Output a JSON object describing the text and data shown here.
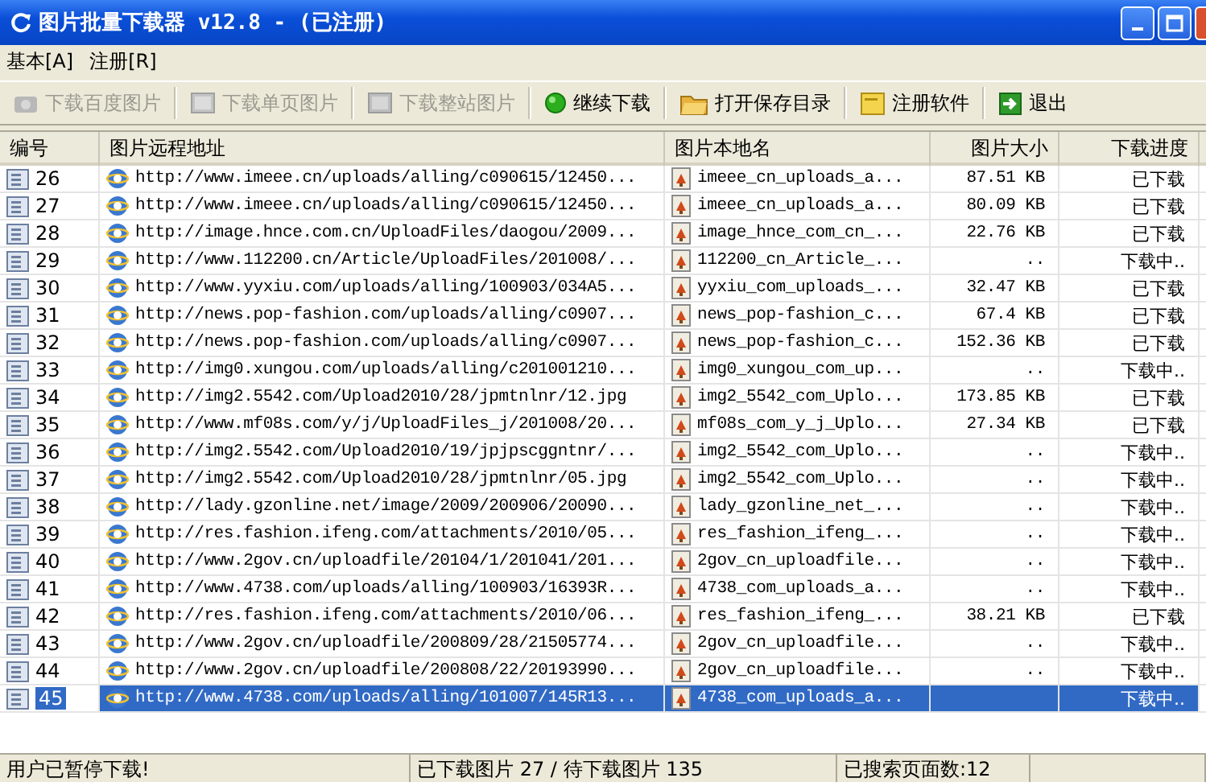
{
  "window": {
    "title": "图片批量下载器 v12.8 - (已注册)"
  },
  "menu": [
    "基本[A]",
    "注册[R]"
  ],
  "toolbar": [
    {
      "label": "下载百度图片",
      "disabled": true
    },
    {
      "label": "下载单页图片",
      "disabled": true
    },
    {
      "label": "下载整站图片",
      "disabled": true
    },
    {
      "label": "继续下载",
      "disabled": false
    },
    {
      "label": "打开保存目录",
      "disabled": false
    },
    {
      "label": "注册软件",
      "disabled": false
    },
    {
      "label": "退出",
      "disabled": false
    }
  ],
  "table": {
    "columns": [
      "编号",
      "图片远程地址",
      "图片本地名",
      "图片大小",
      "下载进度"
    ],
    "rows": [
      {
        "number": "26",
        "url": "http://www.imeee.cn/uploads/alling/c090615/12450...",
        "local_name": "imeee_cn_uploads_a...",
        "size": "87.51 KB",
        "progress": "已下载",
        "selected": false
      },
      {
        "number": "27",
        "url": "http://www.imeee.cn/uploads/alling/c090615/12450...",
        "local_name": "imeee_cn_uploads_a...",
        "size": "80.09 KB",
        "progress": "已下载",
        "selected": false
      },
      {
        "number": "28",
        "url": "http://image.hnce.com.cn/UploadFiles/daogou/2009...",
        "local_name": "image_hnce_com_cn_...",
        "size": "22.76 KB",
        "progress": "已下载",
        "selected": false
      },
      {
        "number": "29",
        "url": "http://www.112200.cn/Article/UploadFiles/201008/...",
        "local_name": "112200_cn_Article_...",
        "size": "..",
        "progress": "下载中..",
        "selected": false
      },
      {
        "number": "30",
        "url": "http://www.yyxiu.com/uploads/alling/100903/034A5...",
        "local_name": "yyxiu_com_uploads_...",
        "size": "32.47 KB",
        "progress": "已下载",
        "selected": false
      },
      {
        "number": "31",
        "url": "http://news.pop-fashion.com/uploads/alling/c0907...",
        "local_name": "news_pop-fashion_c...",
        "size": "67.4 KB",
        "progress": "已下载",
        "selected": false
      },
      {
        "number": "32",
        "url": "http://news.pop-fashion.com/uploads/alling/c0907...",
        "local_name": "news_pop-fashion_c...",
        "size": "152.36 KB",
        "progress": "已下载",
        "selected": false
      },
      {
        "number": "33",
        "url": "http://img0.xungou.com/uploads/alling/c201001210...",
        "local_name": "img0_xungou_com_up...",
        "size": "..",
        "progress": "下载中..",
        "selected": false
      },
      {
        "number": "34",
        "url": "http://img2.5542.com/Upload2010/28/jpmtnlnr/12.jpg",
        "local_name": "img2_5542_com_Uplo...",
        "size": "173.85 KB",
        "progress": "已下载",
        "selected": false
      },
      {
        "number": "35",
        "url": "http://www.mf08s.com/y/j/UploadFiles_j/201008/20...",
        "local_name": "mf08s_com_y_j_Uplo...",
        "size": "27.34 KB",
        "progress": "已下载",
        "selected": false
      },
      {
        "number": "36",
        "url": "http://img2.5542.com/Upload2010/19/jpjpscggntnr/...",
        "local_name": "img2_5542_com_Uplo...",
        "size": "..",
        "progress": "下载中..",
        "selected": false
      },
      {
        "number": "37",
        "url": "http://img2.5542.com/Upload2010/28/jpmtnlnr/05.jpg",
        "local_name": "img2_5542_com_Uplo...",
        "size": "..",
        "progress": "下载中..",
        "selected": false
      },
      {
        "number": "38",
        "url": "http://lady.gzonline.net/image/2009/200906/20090...",
        "local_name": "lady_gzonline_net_...",
        "size": "..",
        "progress": "下载中..",
        "selected": false
      },
      {
        "number": "39",
        "url": "http://res.fashion.ifeng.com/attachments/2010/05...",
        "local_name": "res_fashion_ifeng_...",
        "size": "..",
        "progress": "下载中..",
        "selected": false
      },
      {
        "number": "40",
        "url": "http://www.2gov.cn/uploadfile/20104/1/201041/201...",
        "local_name": "2gov_cn_uploadfile...",
        "size": "..",
        "progress": "下载中..",
        "selected": false
      },
      {
        "number": "41",
        "url": "http://www.4738.com/uploads/alling/100903/16393R...",
        "local_name": "4738_com_uploads_a...",
        "size": "..",
        "progress": "下载中..",
        "selected": false
      },
      {
        "number": "42",
        "url": "http://res.fashion.ifeng.com/attachments/2010/06...",
        "local_name": "res_fashion_ifeng_...",
        "size": "38.21 KB",
        "progress": "已下载",
        "selected": false
      },
      {
        "number": "43",
        "url": "http://www.2gov.cn/uploadfile/200809/28/21505774...",
        "local_name": "2gov_cn_uploadfile...",
        "size": "..",
        "progress": "下载中..",
        "selected": false
      },
      {
        "number": "44",
        "url": "http://www.2gov.cn/uploadfile/200808/22/20193990...",
        "local_name": "2gov_cn_uploadfile...",
        "size": "..",
        "progress": "下载中..",
        "selected": false
      },
      {
        "number": "45",
        "url": "http://www.4738.com/uploads/alling/101007/145R13...",
        "local_name": "4738_com_uploads_a...",
        "progress": "下载中..",
        "selected": true
      }
    ]
  },
  "status_bar": [
    "用户已暂停下载!",
    "已下载图片 27 / 待下载图片 135",
    "已搜索页面数:12"
  ]
}
